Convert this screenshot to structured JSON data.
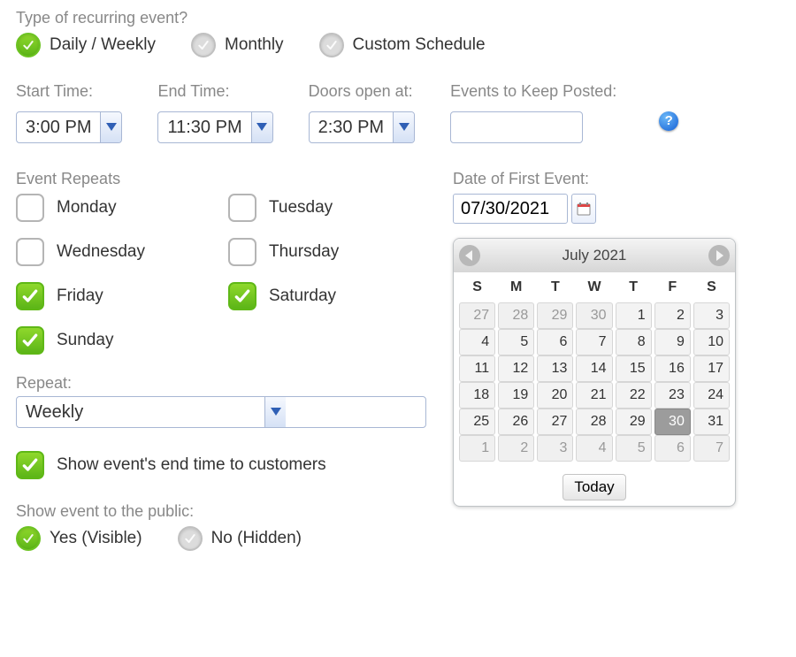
{
  "labels": {
    "type_question": "Type of recurring event?",
    "start_time": "Start Time:",
    "end_time": "End Time:",
    "doors_open": "Doors open at:",
    "events_keep": "Events to Keep Posted:",
    "event_repeats": "Event Repeats",
    "repeat": "Repeat:",
    "date_first": "Date of First Event:",
    "show_end": "Show event's end time to customers",
    "show_public": "Show event to the public:"
  },
  "recurrence_type": {
    "options": [
      {
        "key": "daily_weekly",
        "label": "Daily / Weekly",
        "checked": true
      },
      {
        "key": "monthly",
        "label": "Monthly",
        "checked": false
      },
      {
        "key": "custom",
        "label": "Custom Schedule",
        "checked": false
      }
    ]
  },
  "times": {
    "start": "3:00 PM",
    "end": "11:30 PM",
    "doors": "2:30 PM"
  },
  "events_keep_value": "",
  "days": [
    {
      "key": "mon",
      "label": "Monday",
      "checked": false
    },
    {
      "key": "tue",
      "label": "Tuesday",
      "checked": false
    },
    {
      "key": "wed",
      "label": "Wednesday",
      "checked": false
    },
    {
      "key": "thu",
      "label": "Thursday",
      "checked": false
    },
    {
      "key": "fri",
      "label": "Friday",
      "checked": true
    },
    {
      "key": "sat",
      "label": "Saturday",
      "checked": true
    },
    {
      "key": "sun",
      "label": "Sunday",
      "checked": true
    }
  ],
  "repeat_value": "Weekly",
  "show_end_checked": true,
  "visibility": {
    "options": [
      {
        "key": "yes",
        "label": "Yes (Visible)",
        "checked": true
      },
      {
        "key": "no",
        "label": "No (Hidden)",
        "checked": false
      }
    ]
  },
  "date_first_value": "07/30/2021",
  "calendar": {
    "title": "July 2021",
    "today_label": "Today",
    "dow": [
      "S",
      "M",
      "T",
      "W",
      "T",
      "F",
      "S"
    ],
    "weeks": [
      [
        {
          "n": 27,
          "out": true
        },
        {
          "n": 28,
          "out": true
        },
        {
          "n": 29,
          "out": true
        },
        {
          "n": 30,
          "out": true
        },
        {
          "n": 1
        },
        {
          "n": 2
        },
        {
          "n": 3
        }
      ],
      [
        {
          "n": 4
        },
        {
          "n": 5
        },
        {
          "n": 6
        },
        {
          "n": 7
        },
        {
          "n": 8
        },
        {
          "n": 9
        },
        {
          "n": 10
        }
      ],
      [
        {
          "n": 11
        },
        {
          "n": 12
        },
        {
          "n": 13
        },
        {
          "n": 14
        },
        {
          "n": 15
        },
        {
          "n": 16
        },
        {
          "n": 17
        }
      ],
      [
        {
          "n": 18
        },
        {
          "n": 19
        },
        {
          "n": 20
        },
        {
          "n": 21
        },
        {
          "n": 22
        },
        {
          "n": 23
        },
        {
          "n": 24
        }
      ],
      [
        {
          "n": 25
        },
        {
          "n": 26
        },
        {
          "n": 27
        },
        {
          "n": 28
        },
        {
          "n": 29
        },
        {
          "n": 30,
          "today": true
        },
        {
          "n": 31
        }
      ],
      [
        {
          "n": 1,
          "out": true
        },
        {
          "n": 2,
          "out": true
        },
        {
          "n": 3,
          "out": true
        },
        {
          "n": 4,
          "out": true
        },
        {
          "n": 5,
          "out": true
        },
        {
          "n": 6,
          "out": true
        },
        {
          "n": 7,
          "out": true
        }
      ]
    ]
  }
}
